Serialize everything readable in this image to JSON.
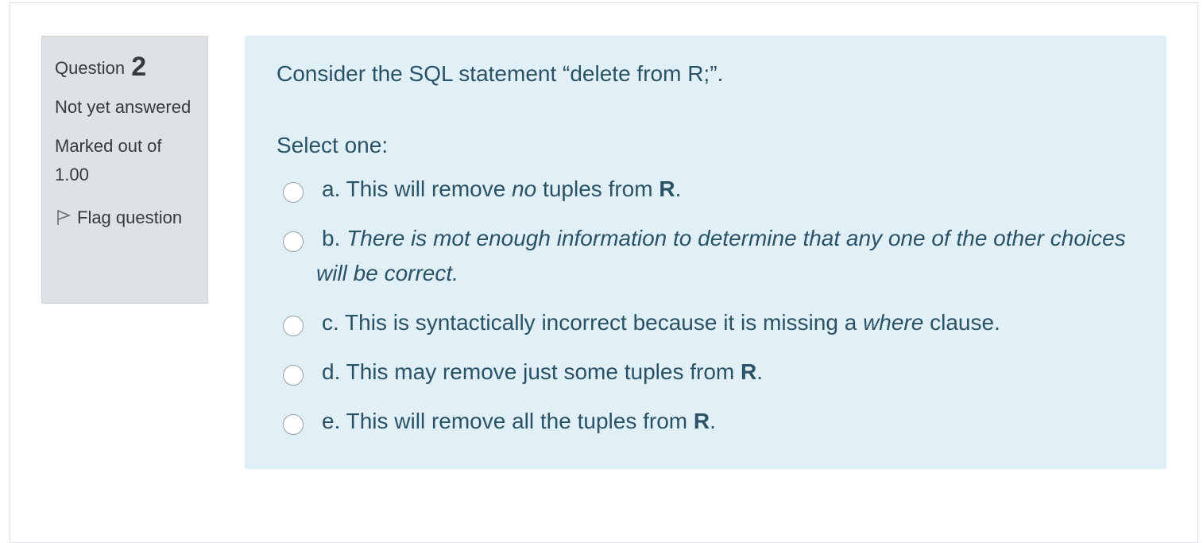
{
  "info": {
    "question_word": "Question",
    "question_number": "2",
    "state": "Not yet answered",
    "grade": "Marked out of 1.00",
    "flag_label": "Flag question"
  },
  "question": {
    "text": "Consider the SQL statement “delete from R;”.",
    "prompt": "Select one:",
    "options": [
      {
        "prefix": "a. This will remove ",
        "italic": "no",
        "mid": " tuples from ",
        "bold": "R",
        "suffix": "."
      },
      {
        "prefix": "b. ",
        "italic": "There is mot enough information to determine that any one of the other choices will be correct.",
        "mid": "",
        "bold": "",
        "suffix": ""
      },
      {
        "prefix": "c. This is syntactically incorrect because it is missing a ",
        "italic": "where",
        "mid": " clause.",
        "bold": "",
        "suffix": ""
      },
      {
        "prefix": "d. This may remove just some tuples from ",
        "italic": "",
        "mid": "",
        "bold": "R",
        "suffix": "."
      },
      {
        "prefix": "e. This will remove all the tuples from ",
        "italic": "",
        "mid": "",
        "bold": "R",
        "suffix": "."
      }
    ]
  },
  "colors": {
    "info_bg": "#dee2e6",
    "content_bg": "#e1f0f6",
    "content_text": "#2a5266"
  }
}
